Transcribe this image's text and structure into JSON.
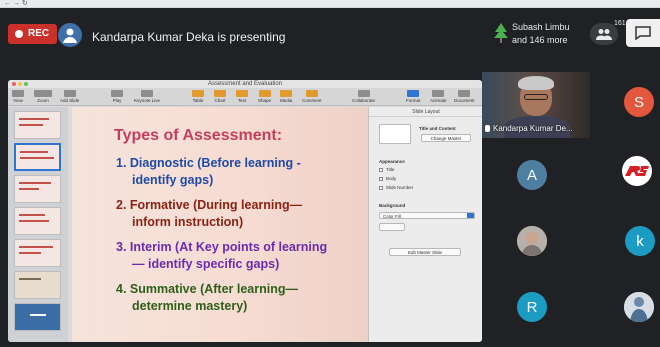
{
  "meet": {
    "rec_label": "REC",
    "presenter_name": "Kandarpa Kumar Deka",
    "presenting_text": "Kandarpa Kumar Deka is presenting",
    "summary_line1": "Subash Limbu",
    "summary_line2": "and 146 more",
    "people_count": "161",
    "presenter_tile_name": "Kandarpa Kumar De...",
    "participants": [
      "S",
      "A",
      "k",
      "R"
    ]
  },
  "keynote": {
    "window_title": "Assessment and Evaluation",
    "zoom": "100%",
    "toolbar": [
      "View",
      "Zoom",
      "Add Slide",
      "Play",
      "Keynote Live",
      "Table",
      "Chart",
      "Text",
      "Shape",
      "Media",
      "Comment",
      "Collaborate",
      "Format",
      "Animate",
      "Document"
    ],
    "inspector": {
      "header": "Slide Layout",
      "layout_name": "Title and Content",
      "change_master": "Change Master",
      "appearance": "Appearance",
      "options": [
        "Title",
        "Body",
        "Slide Number"
      ],
      "background": "Background",
      "fill": "Color Fill",
      "edit_master": "Edit Master Slide"
    }
  },
  "slide": {
    "title": "Types of Assessment:",
    "points": [
      {
        "l1": "1. Diagnostic (Before learning -",
        "l2": "identify gaps)"
      },
      {
        "l1": "2. Formative (During learning—",
        "l2": "inform instruction)"
      },
      {
        "l1": "3. Interim (At Key points of learning",
        "l2": "— identify specific gaps)"
      },
      {
        "l1": "4. Summative (After learning—",
        "l2": "determine mastery)"
      }
    ]
  },
  "colors": {
    "meet_bg": "#202124",
    "rec_red": "#c9312a",
    "slide_title": "#c43f5f",
    "accent_blue": "#2f74d0"
  }
}
